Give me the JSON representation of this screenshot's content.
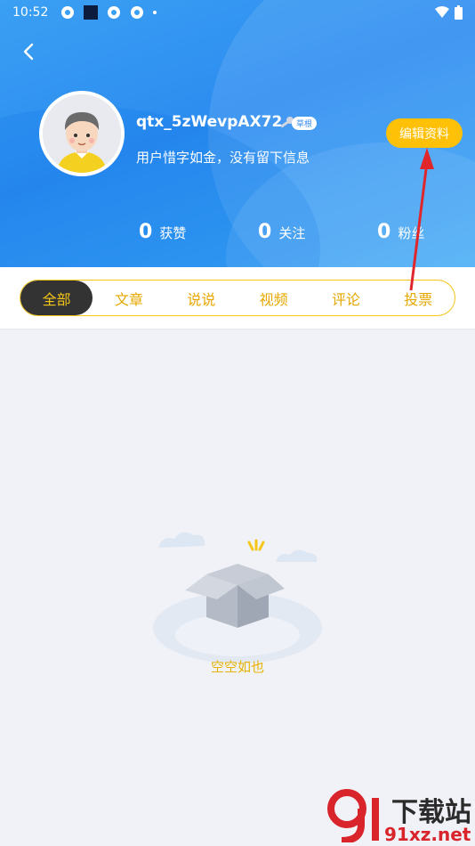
{
  "statusbar": {
    "time": "10:52"
  },
  "profile": {
    "username": "qtx_5zWevpAX72",
    "level_badge": "草根",
    "bio": "用户惜字如金，没有留下信息",
    "edit_button": "编辑资料"
  },
  "stats": [
    {
      "value": "0",
      "label": "获赞"
    },
    {
      "value": "0",
      "label": "关注"
    },
    {
      "value": "0",
      "label": "粉丝"
    }
  ],
  "tabs": [
    {
      "label": "全部",
      "active": true
    },
    {
      "label": "文章",
      "active": false
    },
    {
      "label": "说说",
      "active": false
    },
    {
      "label": "视频",
      "active": false
    },
    {
      "label": "评论",
      "active": false
    },
    {
      "label": "投票",
      "active": false
    }
  ],
  "empty_state": {
    "text": "空空如也"
  },
  "watermark": {
    "main": "下载站",
    "sub": "91xz.net",
    "logo_mark": "9"
  },
  "colors": {
    "header_blue": "#2d8cf0",
    "accent_yellow": "#ffc107",
    "tab_active_bg": "#333333",
    "annotation_red": "#e0262b"
  }
}
